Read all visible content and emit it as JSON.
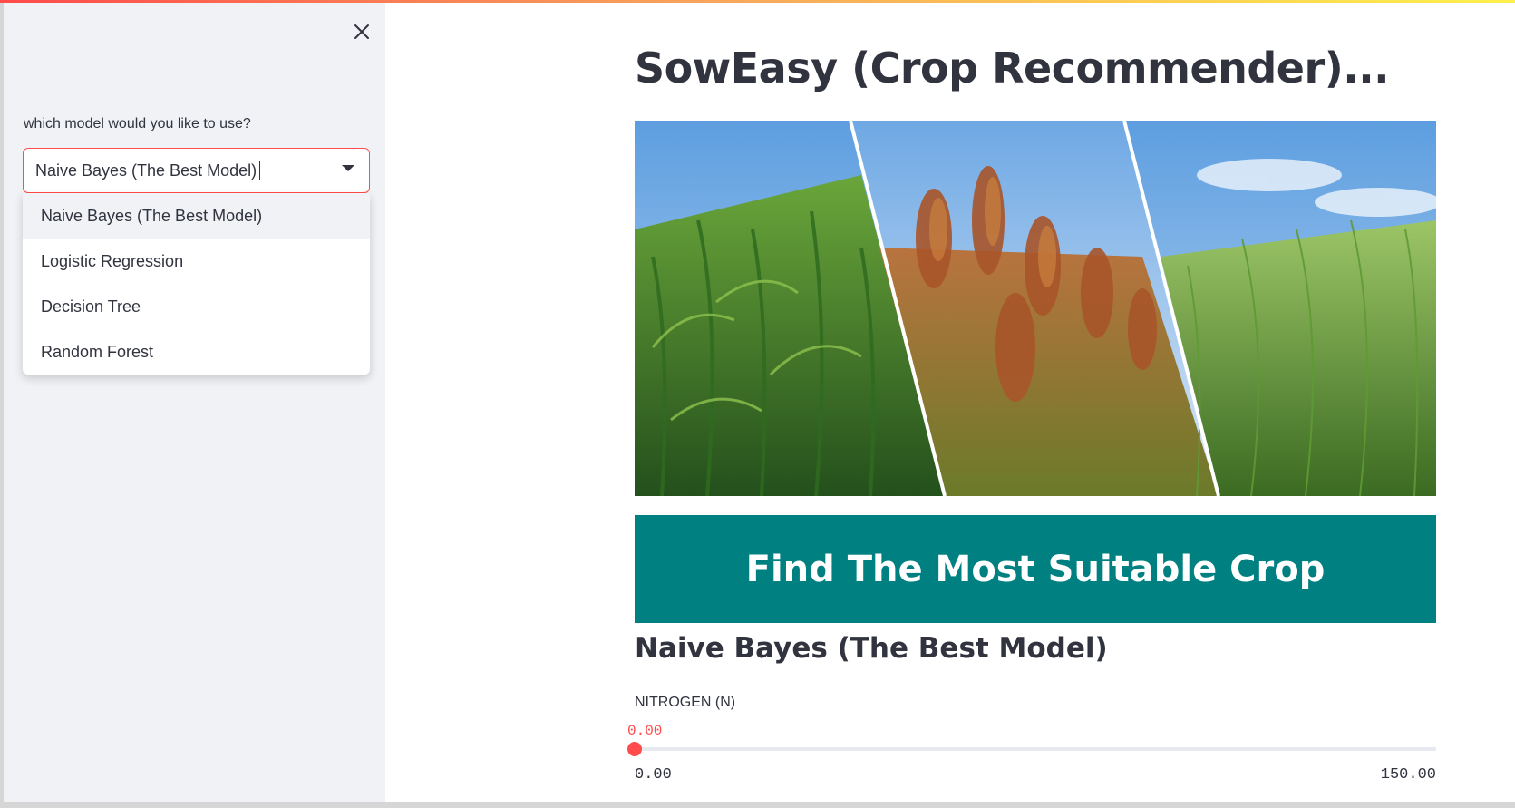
{
  "app": {
    "accent_color": "#ff4b4b",
    "cta_color": "#008080",
    "sidebar_bg": "#f0f2f6"
  },
  "sidebar": {
    "close_icon": "close-icon",
    "select_label": "which model would you like to use?",
    "selected_value": "Naive Bayes (The Best Model)",
    "options": [
      "Naive Bayes (The Best Model)",
      "Logistic Regression",
      "Decision Tree",
      "Random Forest"
    ],
    "active_option_index": 0
  },
  "main": {
    "title": "SowEasy (Crop Recommender)...",
    "hero_image": "crop-fields-image",
    "cta_label": "Find The Most Suitable Crop",
    "model_heading": "Naive Bayes (The Best Model)",
    "slider": {
      "label": "NITROGEN (N)",
      "value_text": "0.00",
      "value": 0.0,
      "min": 0.0,
      "max": 150.0,
      "min_text": "0.00",
      "max_text": "150.00"
    }
  }
}
